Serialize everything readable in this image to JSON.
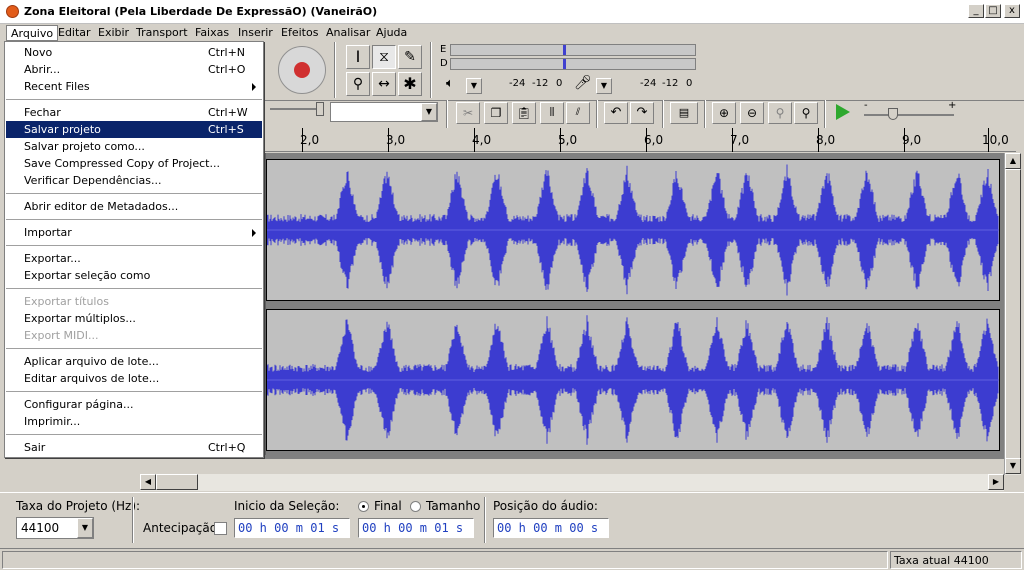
{
  "window": {
    "title": "Zona Eleitoral (Pela Liberdade De ExpressãO) (VaneirãO)",
    "min": "_",
    "max": "□",
    "close": "x"
  },
  "menu": [
    "Arquivo",
    "Editar",
    "Exibir",
    "Transport",
    "Faixas",
    "Inserir",
    "Efeitos",
    "Analisar",
    "Ajuda"
  ],
  "file_menu": {
    "items": [
      {
        "label": "Novo",
        "shortcut": "Ctrl+N"
      },
      {
        "label": "Abrir...",
        "shortcut": "Ctrl+O"
      },
      {
        "label": "Recent Files",
        "shortcut": ""
      },
      {
        "label": "Fechar",
        "shortcut": "Ctrl+W"
      },
      {
        "label": "Salvar projeto",
        "shortcut": "Ctrl+S",
        "highlighted": true
      },
      {
        "label": "Salvar projeto como...",
        "shortcut": ""
      },
      {
        "label": "Save Compressed Copy of Project...",
        "shortcut": ""
      },
      {
        "label": "Verificar Dependências...",
        "shortcut": ""
      },
      {
        "label": "Abrir editor de Metadados...",
        "shortcut": ""
      },
      {
        "label": "Importar",
        "shortcut": ""
      },
      {
        "label": "Exportar...",
        "shortcut": ""
      },
      {
        "label": "Exportar seleção como",
        "shortcut": ""
      },
      {
        "label": "Exportar títulos",
        "shortcut": "",
        "disabled": true
      },
      {
        "label": "Exportar múltiplos...",
        "shortcut": ""
      },
      {
        "label": "Export MIDI...",
        "shortcut": "",
        "disabled": true
      },
      {
        "label": "Aplicar arquivo de lote...",
        "shortcut": ""
      },
      {
        "label": "Editar arquivos de lote...",
        "shortcut": ""
      },
      {
        "label": "Configurar página...",
        "shortcut": ""
      },
      {
        "label": "Imprimir...",
        "shortcut": ""
      },
      {
        "label": "Sair",
        "shortcut": "Ctrl+Q"
      }
    ]
  },
  "meters": {
    "left_label": "E",
    "right_label": "D",
    "ticks": [
      "-24",
      "-12",
      "0"
    ]
  },
  "ruler": {
    "labels": [
      "2,0",
      "3,0",
      "4,0",
      "5,0",
      "6,0",
      "7,0",
      "8,0",
      "9,0",
      "10,0"
    ]
  },
  "bottom": {
    "rate_label": "Taxa do Projeto (Hz):",
    "rate_value": "44100",
    "snap_label": "Antecipação",
    "sel_start_label": "Inicio da Seleção:",
    "end_label": "Final",
    "length_label": "Tamanho",
    "pos_label": "Posição do áudio:",
    "time1": "00 h 00 m 01 s",
    "time2": "00 h 00 m 01 s",
    "time3": "00 h 00 m 00 s"
  },
  "status": {
    "rate": "Taxa atual 44100"
  },
  "colors": {
    "waveform": "#3c3cd0",
    "track_bg": "#c0c0c0",
    "highlight": "#0a246a",
    "play": "#2ea82e"
  }
}
